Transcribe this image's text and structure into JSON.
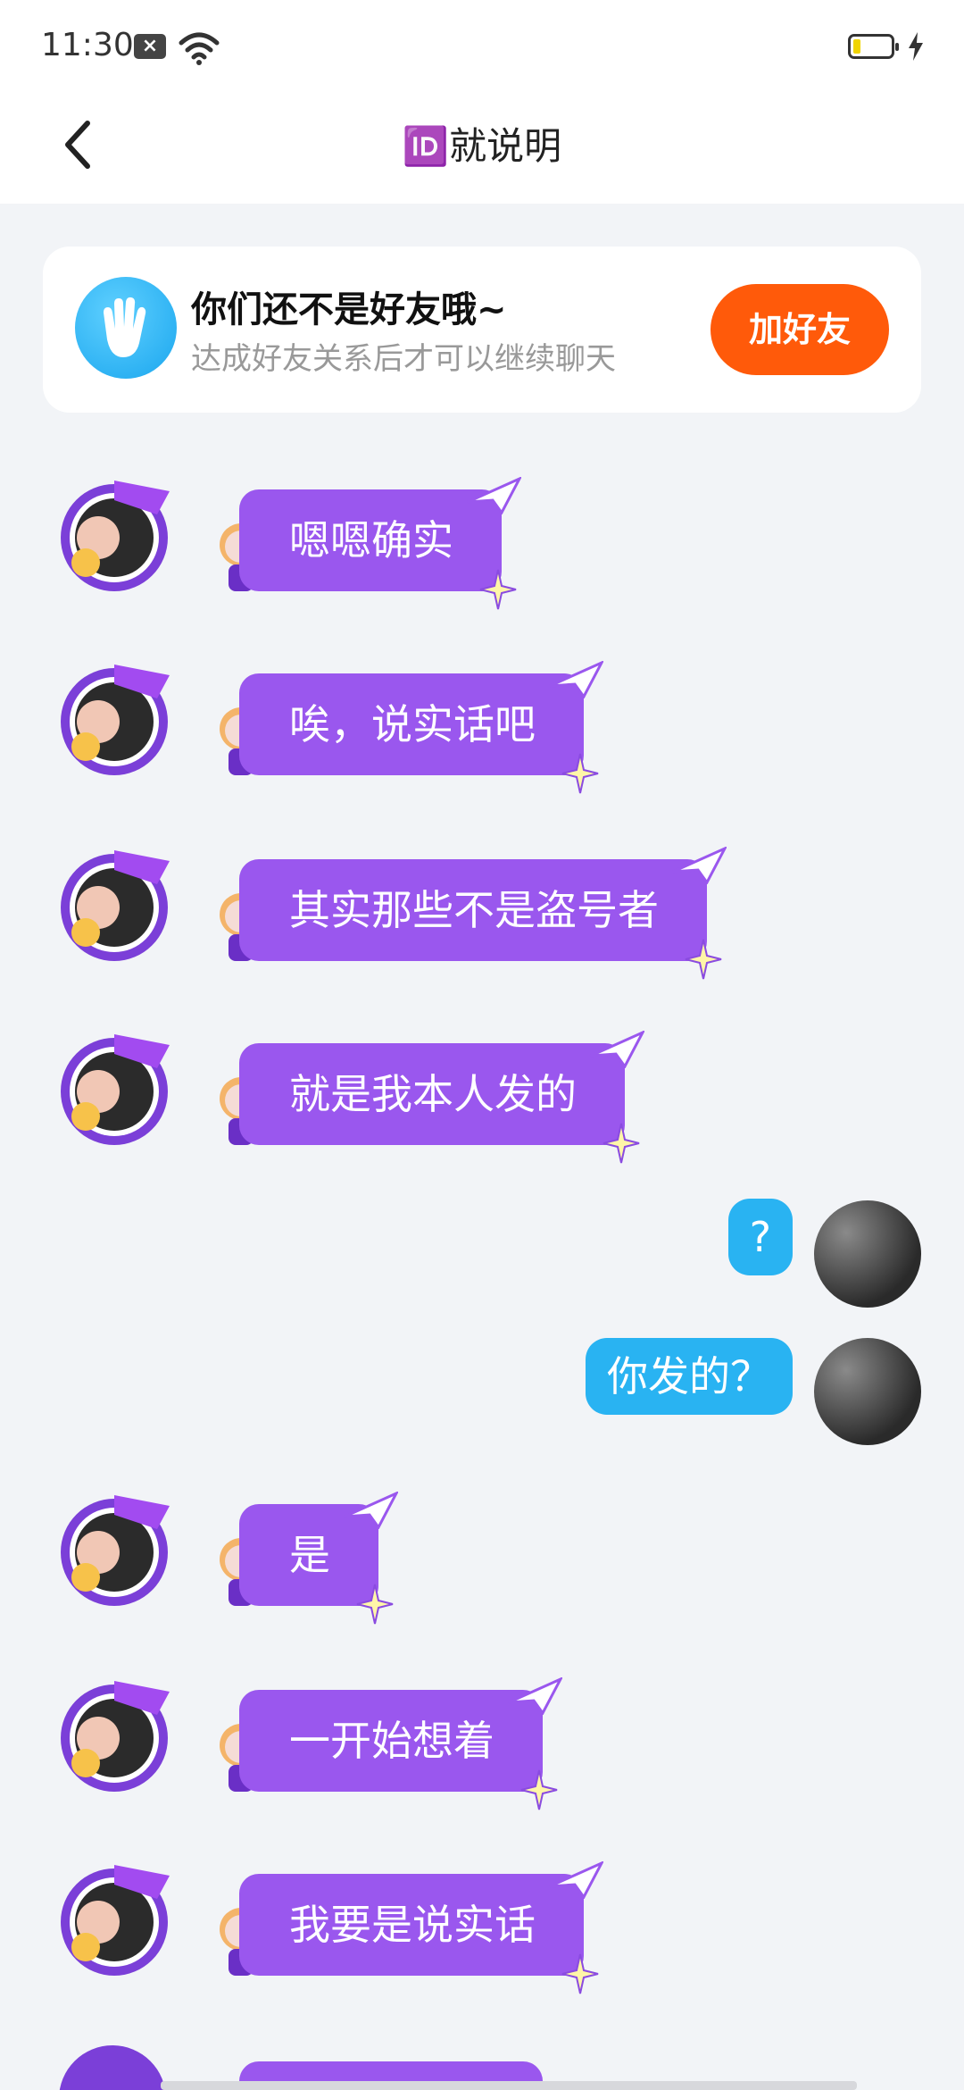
{
  "status_bar": {
    "time": "11:30"
  },
  "header": {
    "title": "🆔就说明"
  },
  "notice": {
    "title": "你们还不是好友哦~",
    "subtitle": "达成好友关系后才可以继续聊天",
    "add_friend_label": "加好友"
  },
  "messages": [
    {
      "side": "left",
      "text": "嗯嗯确实"
    },
    {
      "side": "left",
      "text": "唉，说实话吧"
    },
    {
      "side": "left",
      "text": "其实那些不是盗号者"
    },
    {
      "side": "left",
      "text": "就是我本人发的"
    },
    {
      "side": "right",
      "text": "?"
    },
    {
      "side": "right",
      "text": "你发的？"
    },
    {
      "side": "left",
      "text": "是"
    },
    {
      "side": "left",
      "text": "一开始想着"
    },
    {
      "side": "left",
      "text": "我要是说实话"
    }
  ],
  "colors": {
    "bubble_left": "#9a57ee",
    "bubble_right": "#29b3f2",
    "add_button": "#ff5a0a"
  }
}
